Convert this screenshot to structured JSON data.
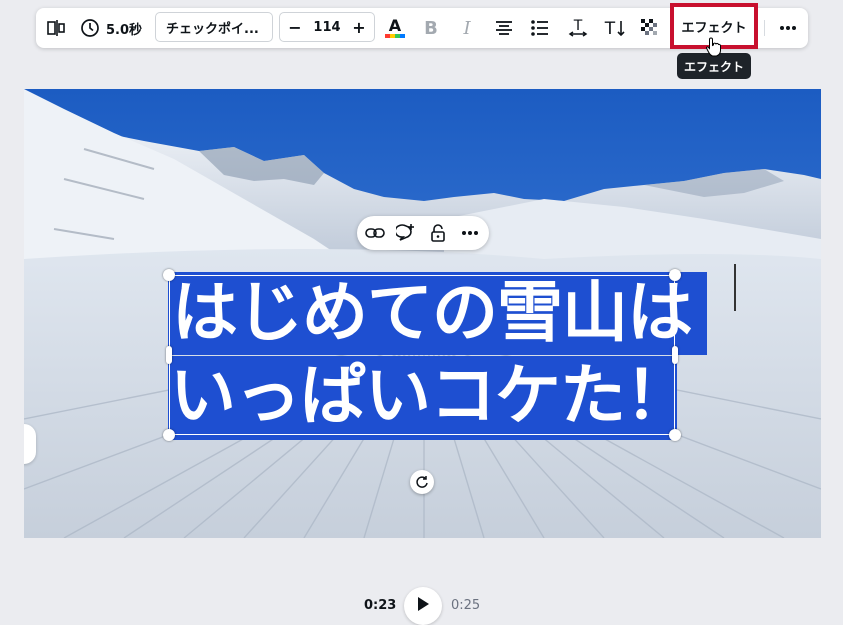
{
  "toolbar": {
    "timer_label": "5.0秒",
    "font_name": "チェックポイ...",
    "font_size": "114",
    "minus_label": "−",
    "plus_label": "+",
    "effects_label": "エフェクト",
    "tooltip": "エフェクト"
  },
  "canvas": {
    "text_line1": "はじめての雪山は",
    "text_line2": "いっぱいコケた！",
    "highlight_color": "#1e4fd1",
    "text_color": "#ffffff"
  },
  "playback": {
    "current_time": "0:23",
    "total_time": "0:25"
  },
  "icons": [
    "split-icon",
    "timer-icon",
    "text-color-icon",
    "bold-icon",
    "italic-icon",
    "align-center-icon",
    "list-icon",
    "letter-spacing-icon",
    "text-direction-icon",
    "transparency-icon",
    "more-icon",
    "link-icon",
    "comment-icon",
    "lock-icon",
    "rotate-icon",
    "play-icon"
  ],
  "accent": "#c8102e"
}
